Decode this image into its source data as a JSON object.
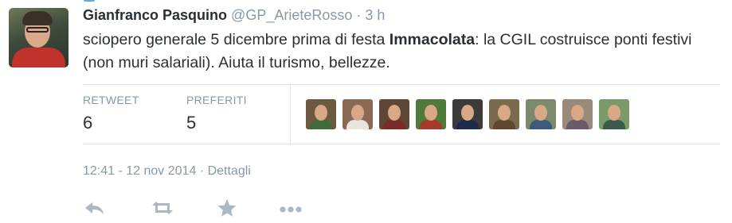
{
  "tweet": {
    "author_name": "Gianfranco Pasquino",
    "handle": "@GP_ArieteRosso",
    "separator": "·",
    "relative_time": "3 h",
    "text_before": "sciopero generale 5 dicembre prima di festa ",
    "text_bold": "Immacolata",
    "text_after": ": la CGIL costruisce ponti festivi (non muri salariali). Aiuta il turismo, bellezze."
  },
  "stats": {
    "retweets_label": "RETWEET",
    "retweets_count": "6",
    "favorites_label": "PREFERITI",
    "favorites_count": "5"
  },
  "favoriters": [
    {
      "name": "favoriter-avatar-1",
      "bg": "#6b5a3f",
      "body": "#3f6b3a"
    },
    {
      "name": "favoriter-avatar-2",
      "bg": "#8a6a55",
      "body": "#e8e4de"
    },
    {
      "name": "favoriter-avatar-3",
      "bg": "#5e4636",
      "body": "#7a2d28"
    },
    {
      "name": "favoriter-avatar-4",
      "bg": "#4f7a3a",
      "body": "#a33a2d"
    },
    {
      "name": "favoriter-avatar-5",
      "bg": "#3d3a3a",
      "body": "#1f2a4a"
    },
    {
      "name": "favoriter-avatar-6",
      "bg": "#7c6a4c",
      "body": "#5e4630"
    },
    {
      "name": "favoriter-avatar-7",
      "bg": "#7a8a6a",
      "body": "#3d5a7a"
    },
    {
      "name": "favoriter-avatar-8",
      "bg": "#9a8a7a",
      "body": "#6a5a6a"
    },
    {
      "name": "favoriter-avatar-9",
      "bg": "#7a9a6a",
      "body": "#3a5a4a"
    }
  ],
  "meta": {
    "timestamp": "12:41 - 12 nov 2014",
    "separator": "·",
    "details_link": "Dettagli"
  },
  "actions": [
    {
      "name": "reply-icon"
    },
    {
      "name": "retweet-icon"
    },
    {
      "name": "favorite-icon"
    },
    {
      "name": "more-icon"
    }
  ],
  "colors": {
    "muted": "#8899a6",
    "text": "#292f33",
    "icon": "#aab8c2",
    "divider": "#e1e8ed",
    "accent": "#55acee"
  }
}
